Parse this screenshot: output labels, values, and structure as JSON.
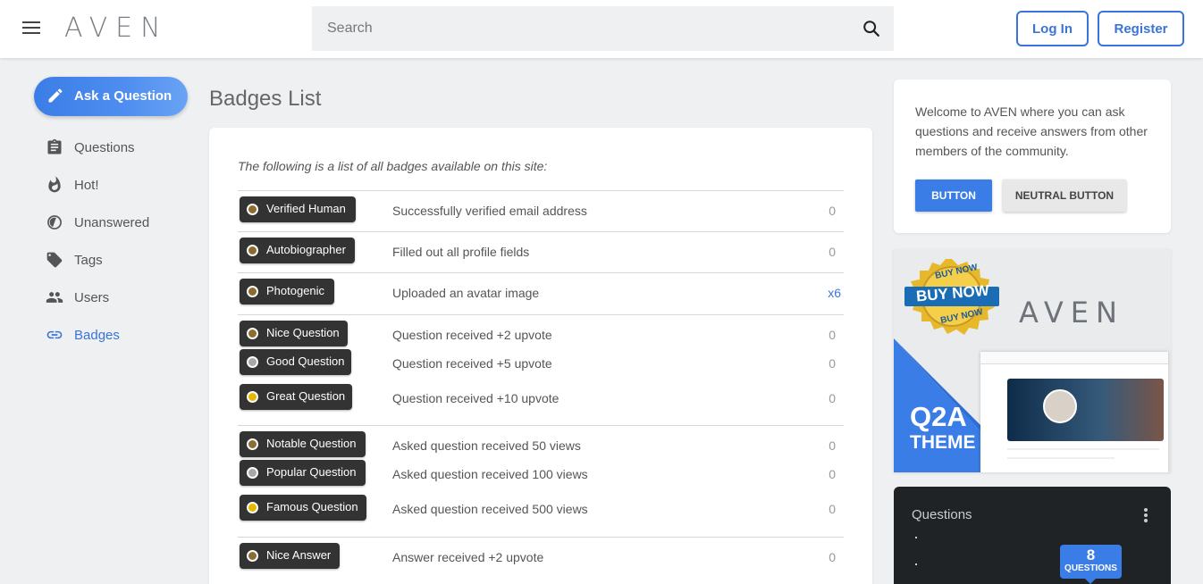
{
  "header": {
    "logo": "AVEN",
    "search_placeholder": "Search",
    "login_label": "Log In",
    "register_label": "Register"
  },
  "sidebar": {
    "ask_label": "Ask a Question",
    "items": [
      {
        "label": "Questions",
        "icon": "clipboard-icon"
      },
      {
        "label": "Hot!",
        "icon": "flame-icon"
      },
      {
        "label": "Unanswered",
        "icon": "half-circle-icon"
      },
      {
        "label": "Tags",
        "icon": "tag-icon"
      },
      {
        "label": "Users",
        "icon": "users-icon"
      },
      {
        "label": "Badges",
        "icon": "link-icon",
        "active": true
      }
    ]
  },
  "main": {
    "title": "Badges List",
    "intro": "The following is a list of all badges available on this site:",
    "badges": [
      {
        "name": "Verified Human",
        "desc": "Successfully verified email address",
        "count": "0",
        "level": "bronze"
      },
      {
        "name": "Autobiographer",
        "desc": "Filled out all profile fields",
        "count": "0",
        "level": "bronze"
      },
      {
        "name": "Photogenic",
        "desc": "Uploaded an avatar image",
        "count": "x6",
        "level": "bronze"
      },
      {
        "name": "Nice Question",
        "desc": "Question received +2 upvote",
        "count": "0",
        "level": "bronze"
      },
      {
        "name": "Good Question",
        "desc": "Question received +5 upvote",
        "count": "0",
        "level": "silver"
      },
      {
        "name": "Great Question",
        "desc": "Question received +10 upvote",
        "count": "0",
        "level": "gold"
      },
      {
        "name": "Notable Question",
        "desc": "Asked question received 50 views",
        "count": "0",
        "level": "bronze"
      },
      {
        "name": "Popular Question",
        "desc": "Asked question received 100 views",
        "count": "0",
        "level": "silver"
      },
      {
        "name": "Famous Question",
        "desc": "Asked question received 500 views",
        "count": "0",
        "level": "gold"
      },
      {
        "name": "Nice Answer",
        "desc": "Answer received +2 upvote",
        "count": "0",
        "level": "bronze"
      }
    ]
  },
  "colors": {
    "accent": "#3a74d8",
    "bronze": "#8b6d2f",
    "silver": "#a8a8a8",
    "gold": "#e6b800",
    "pill": "#333333"
  },
  "welcome": {
    "text": "Welcome to AVEN where you can ask questions and receive answers from other members of the community.",
    "button_label": "BUTTON",
    "neutral_label": "NEUTRAL BUTTON"
  },
  "promo": {
    "seal_top": "BUY NOW",
    "seal_main": "BUY NOW",
    "seal_bottom": "BUY NOW",
    "logo": "AVEN",
    "title_line1": "Q2A",
    "title_line2": "THEME"
  },
  "questions_widget": {
    "title": "Questions",
    "count": "8",
    "count_label": "QUESTIONS"
  }
}
